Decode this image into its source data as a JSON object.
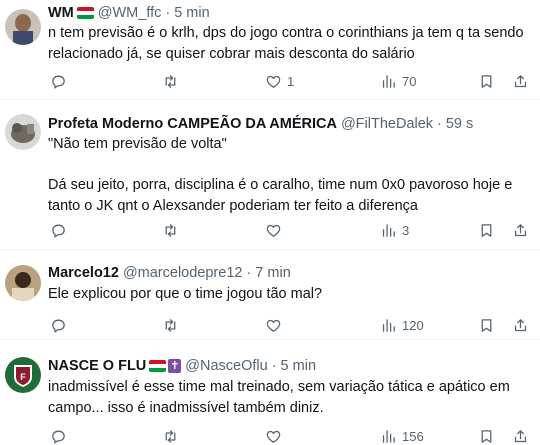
{
  "tweets": [
    {
      "name": "WM",
      "flag": [
        "#ce1126",
        "#ffffff",
        "#009c3b"
      ],
      "handle": "@WM_ffc",
      "dot": "·",
      "time": "5 min",
      "lines": [
        "n tem previsão é o krlh, dps do jogo contra o corinthians ja tem q ta sendo",
        "relacionado já, se quiser cobrar mais desconta do salário"
      ],
      "replies": "",
      "retweets": "",
      "likes": "1",
      "views": "70"
    },
    {
      "name": "Profeta Moderno CAMPEÃO DA AMÉRICA",
      "handle": "@FilTheDalek",
      "dot": "·",
      "time": "59 s",
      "lines": [
        "\"Não tem previsão de volta\"",
        "",
        "Dá seu jeito, porra, disciplina é o caralho, time num 0x0 pavoroso hoje e",
        "tanto o JK qnt o Alexsander poderiam ter feito a diferença"
      ],
      "replies": "",
      "retweets": "",
      "likes": "",
      "views": "3"
    },
    {
      "name": "Marcelo12",
      "handle": "@marcelodepre12",
      "dot": "·",
      "time": "7 min",
      "lines": [
        "Ele explicou por que o time jogou tão mal?"
      ],
      "replies": "",
      "retweets": "",
      "likes": "",
      "views": "120"
    },
    {
      "name": "NASCE O FLU",
      "flag": [
        "#ce1126",
        "#ffffff",
        "#009c3b"
      ],
      "badge": "✝",
      "handle": "@NasceOflu",
      "dot": "·",
      "time": "5 min",
      "lines": [
        "inadmissível é esse time mal treinado, sem variação tática e apático em",
        "campo... isso é inadmissível também diniz."
      ],
      "replies": "",
      "retweets": "",
      "likes": "",
      "views": "156"
    }
  ],
  "colors": {
    "text": "#0f1419",
    "secondary": "#536471",
    "divider": "#eff3f4"
  },
  "icons": [
    "reply-icon",
    "retweet-icon",
    "like-icon",
    "views-icon",
    "bookmark-icon",
    "share-icon"
  ]
}
